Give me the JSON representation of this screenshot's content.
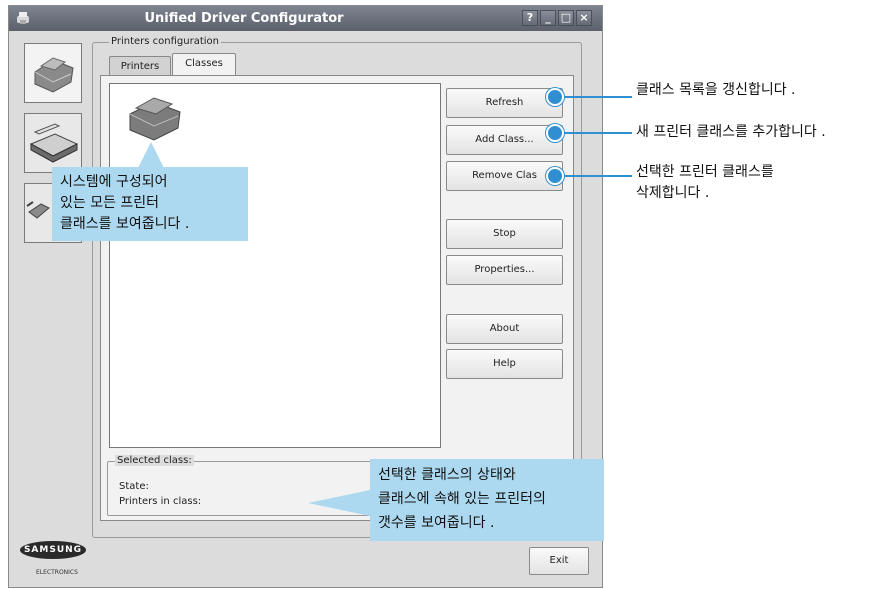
{
  "window": {
    "title": "Unified Driver Configurator",
    "controls": [
      "?",
      "_",
      "□",
      "×"
    ]
  },
  "sidebar": {
    "items": [
      {
        "name": "printers-config-button",
        "icon": "printer-icon"
      },
      {
        "name": "scanners-config-button",
        "icon": "scanner-icon"
      },
      {
        "name": "ports-config-button",
        "icon": "port-icon"
      }
    ]
  },
  "group_label": "Printers configuration",
  "tabs": [
    {
      "label": "Printers",
      "active": false
    },
    {
      "label": "Classes",
      "active": true
    }
  ],
  "buttons": {
    "refresh": "Refresh",
    "add_class": "Add Class...",
    "remove_class": "Remove Clas",
    "stop": "Stop",
    "properties": "Properties...",
    "about": "About",
    "help": "Help",
    "exit": "Exit"
  },
  "selected_class": {
    "label": "Selected class:",
    "state_label": "State:",
    "printers_label": "Printers in class:"
  },
  "logo": {
    "brand": "SAMSUNG",
    "sub": "ELECTRONICS"
  },
  "annotations": {
    "refresh": "클래스 목록을 갱신합니다 .",
    "add": "새 프린터 클래스를 추가합니다 .",
    "remove_1": "선택한 프린터 클래스를",
    "remove_2": "삭제합니다 .",
    "list_1": "시스템에 구성되어",
    "list_2": "있는 모든 프린터",
    "list_3": "클래스를 보여줍니다 .",
    "status_1": "선택한 클래스의 상태와",
    "status_2": "클래스에 속해 있는 프린터의",
    "status_3": "갯수를 보여줍니다 ."
  },
  "colors": {
    "callout_bg": "#add9f0",
    "callout_accent": "#2f8fd0",
    "titlebar": "#5b606b"
  }
}
